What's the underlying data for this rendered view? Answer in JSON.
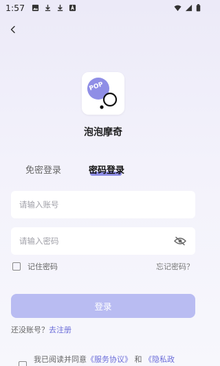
{
  "status_bar": {
    "time": "1:57",
    "left_icons": [
      "gallery-icon",
      "download-icon",
      "download-icon",
      "app-a-icon"
    ],
    "right_icons": [
      "wifi-icon",
      "signal-icon",
      "battery-icon"
    ]
  },
  "header": {
    "back_icon": "chevron-left-icon"
  },
  "app": {
    "name": "泡泡摩奇",
    "logo_text": "POP",
    "logo_color": "#8f8ee6"
  },
  "tabs": [
    {
      "label": "免密登录",
      "active": false
    },
    {
      "label": "密码登录",
      "active": true
    }
  ],
  "form": {
    "account_placeholder": "请输入账号",
    "account_value": "",
    "password_placeholder": "请输入密码",
    "password_value": "",
    "password_visibility_icon": "eye-off-icon",
    "remember_label": "记住密码",
    "remember_checked": false,
    "forgot_label": "忘记密码？",
    "login_label": "登录"
  },
  "register": {
    "prompt": "还没账号？",
    "link": "去注册"
  },
  "agreement": {
    "prefix": "我已阅读并同意",
    "service_link": "《服务协议》",
    "conjunction": "和",
    "privacy_link": "《隐私政"
  },
  "colors": {
    "accent": "#6b6dd9",
    "button_disabled": "#b9bcf2",
    "tab_indicator": "#8f8ee6"
  }
}
